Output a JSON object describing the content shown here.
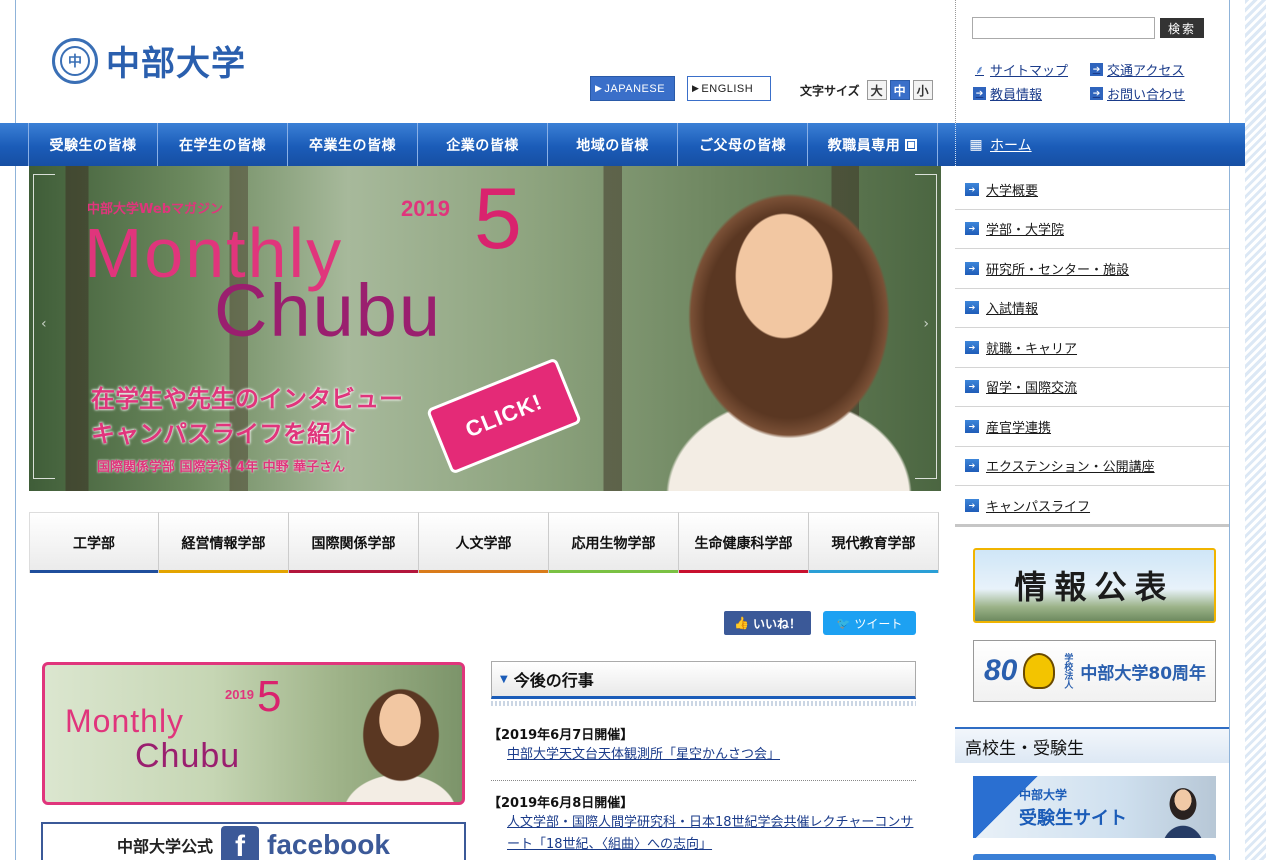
{
  "header": {
    "logo_text": "中部大学",
    "logo_mark": "中",
    "lang_japanese": "JAPANESE",
    "lang_english": "ENGLISH",
    "font_size_label": "文字サイズ",
    "font_size_large": "大",
    "font_size_medium": "中",
    "font_size_small": "小",
    "search_placeholder": "",
    "search_button": "検索",
    "util_links": [
      "サイトマップ",
      "交通アクセス",
      "教員情報",
      "お問い合わせ"
    ]
  },
  "gnav": {
    "items": [
      "受験生の皆様",
      "在学生の皆様",
      "卒業生の皆様",
      "企業の皆様",
      "地域の皆様",
      "ご父母の皆様",
      "教職員専用"
    ],
    "home": "ホーム"
  },
  "hero": {
    "magazine_label": "中部大学Webマガジン",
    "year": "2019",
    "issue": "5",
    "title_line1": "Monthly",
    "title_line2": "Chubu",
    "catch_line1": "在学生や先生のインタビュー",
    "catch_line2": "キャンパスライフを紹介",
    "person_label": "国際関係学部 国際学科 4年 中野 華子さん",
    "click_label": "CLICK!"
  },
  "faculties": [
    {
      "label": "工学部",
      "color": "#1f4e9c"
    },
    {
      "label": "経営情報学部",
      "color": "#e3a400"
    },
    {
      "label": "国際関係学部",
      "color": "#b3153c"
    },
    {
      "label": "人文学部",
      "color": "#d97b1a"
    },
    {
      "label": "応用生物学部",
      "color": "#7ac143"
    },
    {
      "label": "生命健康科学部",
      "color": "#c8102e"
    },
    {
      "label": "現代教育学部",
      "color": "#2a9fd6"
    }
  ],
  "social": {
    "like": "いいね！",
    "tweet": "ツイート"
  },
  "mini_banner": {
    "year": "2019",
    "issue": "5",
    "title_line1": "Monthly",
    "title_line2": "Chubu"
  },
  "facebook_banner": {
    "text": "中部大学公式",
    "f": "f",
    "word": "facebook"
  },
  "events": {
    "title": "今後の行事",
    "items": [
      {
        "date": "【2019年6月7日開催】",
        "title": "中部大学天文台天体観測所「星空かんさつ会」"
      },
      {
        "date": "【2019年6月8日開催】",
        "title": "人文学部・国際人間学研究科・日本18世紀学会共催レクチャーコンサート「18世紀、〈組曲〉への志向」"
      }
    ]
  },
  "side_menu": {
    "items": [
      "大学概要",
      "学部・大学院",
      "研究所・センター・施設",
      "入試情報",
      "就職・キャリア",
      "留学・国際交流",
      "産官学連携",
      "エクステンション・公開講座",
      "キャンパスライフ"
    ]
  },
  "side_banners": {
    "info": "情報公表",
    "anniv_number": "80",
    "anniv_small": "学校法人",
    "anniv_text": "中部大学80周年",
    "section_title": "高校生・受験生",
    "exam_line1": "中部大学",
    "exam_line2": "受験生サイト"
  }
}
